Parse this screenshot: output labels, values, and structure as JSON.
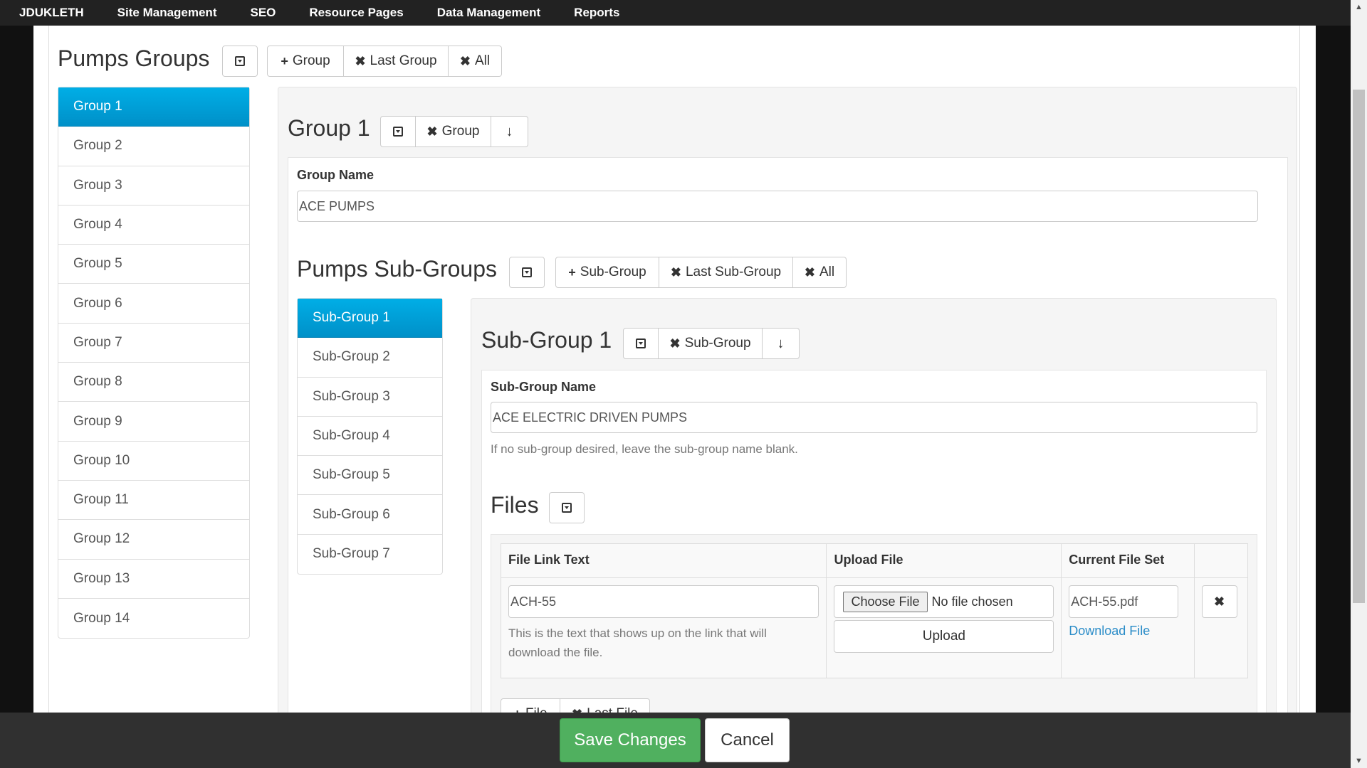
{
  "nav": {
    "brand": "JDUKLETH",
    "items": [
      "Site Management",
      "SEO",
      "Resource Pages",
      "Data Management",
      "Reports"
    ]
  },
  "groups_section": {
    "title": "Pumps Groups",
    "add_label": "Group",
    "remove_last_label": "Last Group",
    "remove_all_label": "All",
    "items": [
      "Group 1",
      "Group 2",
      "Group 3",
      "Group 4",
      "Group 5",
      "Group 6",
      "Group 7",
      "Group 8",
      "Group 9",
      "Group 10",
      "Group 11",
      "Group 12",
      "Group 13",
      "Group 14"
    ],
    "active_index": 0
  },
  "group_detail": {
    "title": "Group 1",
    "remove_label": "Group",
    "name_label": "Group Name",
    "name_value": "ACE PUMPS"
  },
  "subgroups_section": {
    "title": "Pumps Sub-Groups",
    "add_label": "Sub-Group",
    "remove_last_label": "Last Sub-Group",
    "remove_all_label": "All",
    "items": [
      "Sub-Group 1",
      "Sub-Group 2",
      "Sub-Group 3",
      "Sub-Group 4",
      "Sub-Group 5",
      "Sub-Group 6",
      "Sub-Group 7"
    ],
    "active_index": 0
  },
  "subgroup_detail": {
    "title": "Sub-Group 1",
    "remove_label": "Sub-Group",
    "name_label": "Sub-Group Name",
    "name_value": "ACE ELECTRIC DRIVEN PUMPS",
    "help": "If no sub-group desired, leave the sub-group name blank."
  },
  "files": {
    "title": "Files",
    "columns": [
      "File Link Text",
      "Upload File",
      "Current File Set"
    ],
    "row": {
      "link_text": "ACH-55",
      "link_help": "This is the text that shows up on the link that will download the file.",
      "choose_file": "Choose File",
      "no_file": "No file chosen",
      "upload": "Upload",
      "current_file": "ACH-55.pdf",
      "download": "Download File"
    },
    "add_label": "File",
    "remove_last_label": "Last File"
  },
  "footer": {
    "save": "Save Changes",
    "cancel": "Cancel"
  },
  "colors": {
    "active_item": "#00a0d8",
    "save_button": "#50b05f",
    "link": "#2a8cc8"
  }
}
